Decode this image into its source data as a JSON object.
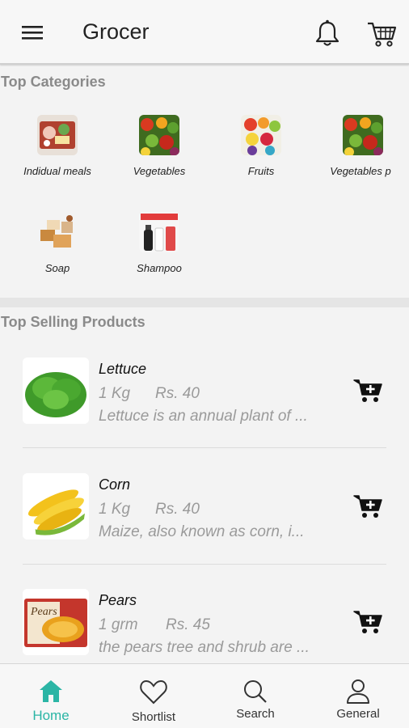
{
  "app": {
    "title": "Grocer"
  },
  "categories": {
    "title": "Top Categories",
    "items": [
      {
        "label": "Indidual meals",
        "icon": "meals-image"
      },
      {
        "label": "Vegetables",
        "icon": "vegetables-image"
      },
      {
        "label": "Fruits",
        "icon": "fruits-image"
      },
      {
        "label": "Vegetables p",
        "icon": "vegetables-image"
      },
      {
        "label": "Soap",
        "icon": "soap-image"
      },
      {
        "label": "Shampoo",
        "icon": "shampoo-image"
      }
    ]
  },
  "products": {
    "title": "Top Selling Products",
    "items": [
      {
        "name": "Lettuce",
        "qty": "1 Kg",
        "price": "Rs. 40",
        "desc": "Lettuce is an annual plant of ..."
      },
      {
        "name": "Corn",
        "qty": "1 Kg",
        "price": "Rs. 40",
        "desc": "Maize,  also known as corn,  i..."
      },
      {
        "name": "Pears",
        "qty": "1 grm",
        "price": "Rs. 45",
        "desc": "the pears tree and shrub are ..."
      }
    ]
  },
  "nav": {
    "items": [
      {
        "label": "Home",
        "icon": "home-icon",
        "active": true
      },
      {
        "label": "Shortlist",
        "icon": "heart-icon",
        "active": false
      },
      {
        "label": "Search",
        "icon": "search-icon",
        "active": false
      },
      {
        "label": "General",
        "icon": "person-icon",
        "active": false
      }
    ]
  },
  "colors": {
    "accent": "#2bb5a5",
    "muted_text": "#9a9a9a",
    "section_title": "#8a8a8a"
  }
}
